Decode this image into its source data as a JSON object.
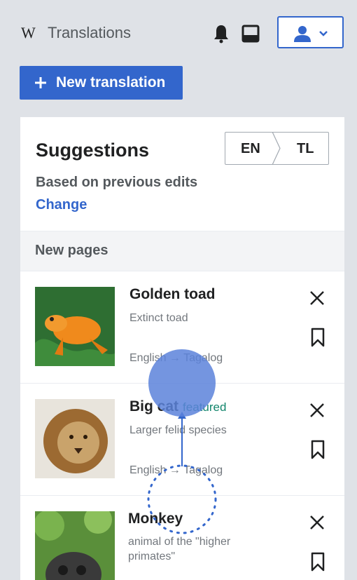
{
  "header": {
    "logo": "W",
    "title": "Translations"
  },
  "actions": {
    "new_translation": "New translation"
  },
  "suggestions": {
    "title": "Suggestions",
    "source_lang": "EN",
    "target_lang": "TL",
    "based_on": "Based on previous edits",
    "change_label": "Change",
    "section_title": "New pages",
    "items": [
      {
        "title": "Golden toad",
        "badge": "",
        "description": "Extinct toad",
        "languages": "English → Tagalog",
        "thumb_color": "#f08a1c"
      },
      {
        "title": "Big cat",
        "badge": "featured",
        "description": "Larger felid species",
        "languages": "English → Tagalog",
        "thumb_color": "#b8894e"
      },
      {
        "title": "Monkey",
        "badge": "",
        "description": "animal of the \"higher primates\"",
        "languages": "",
        "thumb_color": "#6aa84f"
      }
    ]
  },
  "colors": {
    "accent": "#3366cc",
    "featured": "#14866d",
    "touch_indicator": "#5c82db"
  },
  "gesture": "swipe-up"
}
